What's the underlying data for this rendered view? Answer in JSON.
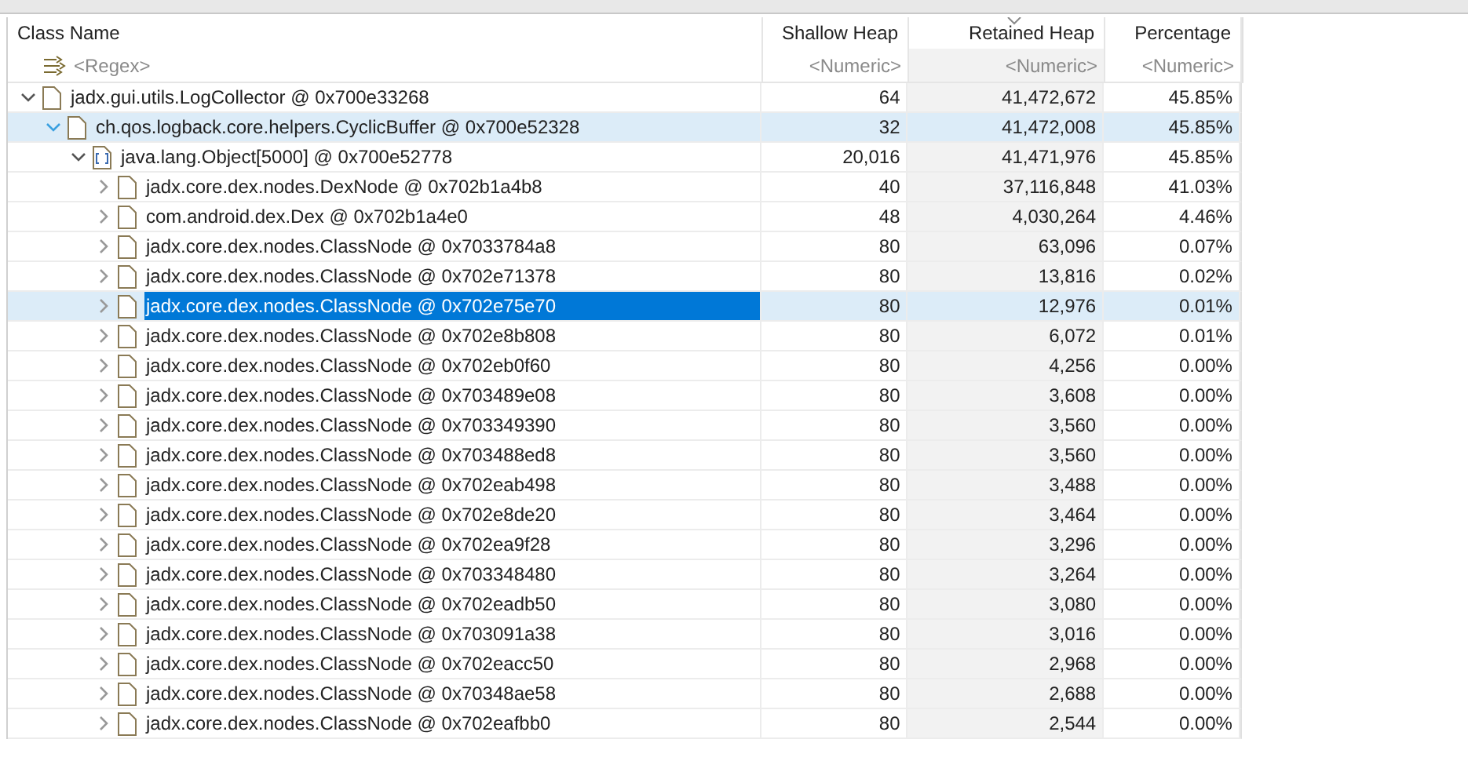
{
  "columns": [
    {
      "label": "Class Name",
      "filter": "<Regex>",
      "sorted": false
    },
    {
      "label": "Shallow Heap",
      "filter": "<Numeric>",
      "sorted": false
    },
    {
      "label": "Retained Heap",
      "filter": "<Numeric>",
      "sorted": true
    },
    {
      "label": "Percentage",
      "filter": "<Numeric>",
      "sorted": false
    }
  ],
  "rows": [
    {
      "kind": "object",
      "name": "jadx.gui.utils.LogCollector @ 0x700e33268",
      "shallow": "64",
      "retained": "41,472,672",
      "percentage": "45.85%",
      "expanded": true,
      "selected": false,
      "hovered": false,
      "children": [
        {
          "kind": "object",
          "name": "ch.qos.logback.core.helpers.CyclicBuffer @ 0x700e52328",
          "shallow": "32",
          "retained": "41,472,008",
          "percentage": "45.85%",
          "expanded": true,
          "selected": false,
          "hovered": true,
          "children": [
            {
              "kind": "array",
              "name": "java.lang.Object[5000] @ 0x700e52778",
              "shallow": "20,016",
              "retained": "41,471,976",
              "percentage": "45.85%",
              "expanded": true,
              "selected": false,
              "hovered": false,
              "children": [
                {
                  "kind": "object",
                  "name": "jadx.core.dex.nodes.DexNode @ 0x702b1a4b8",
                  "shallow": "40",
                  "retained": "37,116,848",
                  "percentage": "41.03%",
                  "expanded": false,
                  "selected": false,
                  "hovered": false
                },
                {
                  "kind": "object",
                  "name": "com.android.dex.Dex @ 0x702b1a4e0",
                  "shallow": "48",
                  "retained": "4,030,264",
                  "percentage": "4.46%",
                  "expanded": false,
                  "selected": false,
                  "hovered": false
                },
                {
                  "kind": "object",
                  "name": "jadx.core.dex.nodes.ClassNode @ 0x7033784a8",
                  "shallow": "80",
                  "retained": "63,096",
                  "percentage": "0.07%",
                  "expanded": false,
                  "selected": false,
                  "hovered": false
                },
                {
                  "kind": "object",
                  "name": "jadx.core.dex.nodes.ClassNode @ 0x702e71378",
                  "shallow": "80",
                  "retained": "13,816",
                  "percentage": "0.02%",
                  "expanded": false,
                  "selected": false,
                  "hovered": false
                },
                {
                  "kind": "object",
                  "name": "jadx.core.dex.nodes.ClassNode @ 0x702e75e70",
                  "shallow": "80",
                  "retained": "12,976",
                  "percentage": "0.01%",
                  "expanded": false,
                  "selected": true,
                  "hovered": false
                },
                {
                  "kind": "object",
                  "name": "jadx.core.dex.nodes.ClassNode @ 0x702e8b808",
                  "shallow": "80",
                  "retained": "6,072",
                  "percentage": "0.01%",
                  "expanded": false,
                  "selected": false,
                  "hovered": false
                },
                {
                  "kind": "object",
                  "name": "jadx.core.dex.nodes.ClassNode @ 0x702eb0f60",
                  "shallow": "80",
                  "retained": "4,256",
                  "percentage": "0.00%",
                  "expanded": false,
                  "selected": false,
                  "hovered": false
                },
                {
                  "kind": "object",
                  "name": "jadx.core.dex.nodes.ClassNode @ 0x703489e08",
                  "shallow": "80",
                  "retained": "3,608",
                  "percentage": "0.00%",
                  "expanded": false,
                  "selected": false,
                  "hovered": false
                },
                {
                  "kind": "object",
                  "name": "jadx.core.dex.nodes.ClassNode @ 0x703349390",
                  "shallow": "80",
                  "retained": "3,560",
                  "percentage": "0.00%",
                  "expanded": false,
                  "selected": false,
                  "hovered": false
                },
                {
                  "kind": "object",
                  "name": "jadx.core.dex.nodes.ClassNode @ 0x703488ed8",
                  "shallow": "80",
                  "retained": "3,560",
                  "percentage": "0.00%",
                  "expanded": false,
                  "selected": false,
                  "hovered": false
                },
                {
                  "kind": "object",
                  "name": "jadx.core.dex.nodes.ClassNode @ 0x702eab498",
                  "shallow": "80",
                  "retained": "3,488",
                  "percentage": "0.00%",
                  "expanded": false,
                  "selected": false,
                  "hovered": false
                },
                {
                  "kind": "object",
                  "name": "jadx.core.dex.nodes.ClassNode @ 0x702e8de20",
                  "shallow": "80",
                  "retained": "3,464",
                  "percentage": "0.00%",
                  "expanded": false,
                  "selected": false,
                  "hovered": false
                },
                {
                  "kind": "object",
                  "name": "jadx.core.dex.nodes.ClassNode @ 0x702ea9f28",
                  "shallow": "80",
                  "retained": "3,296",
                  "percentage": "0.00%",
                  "expanded": false,
                  "selected": false,
                  "hovered": false
                },
                {
                  "kind": "object",
                  "name": "jadx.core.dex.nodes.ClassNode @ 0x703348480",
                  "shallow": "80",
                  "retained": "3,264",
                  "percentage": "0.00%",
                  "expanded": false,
                  "selected": false,
                  "hovered": false
                },
                {
                  "kind": "object",
                  "name": "jadx.core.dex.nodes.ClassNode @ 0x702eadb50",
                  "shallow": "80",
                  "retained": "3,080",
                  "percentage": "0.00%",
                  "expanded": false,
                  "selected": false,
                  "hovered": false
                },
                {
                  "kind": "object",
                  "name": "jadx.core.dex.nodes.ClassNode @ 0x703091a38",
                  "shallow": "80",
                  "retained": "3,016",
                  "percentage": "0.00%",
                  "expanded": false,
                  "selected": false,
                  "hovered": false
                },
                {
                  "kind": "object",
                  "name": "jadx.core.dex.nodes.ClassNode @ 0x702eacc50",
                  "shallow": "80",
                  "retained": "2,968",
                  "percentage": "0.00%",
                  "expanded": false,
                  "selected": false,
                  "hovered": false
                },
                {
                  "kind": "object",
                  "name": "jadx.core.dex.nodes.ClassNode @ 0x70348ae58",
                  "shallow": "80",
                  "retained": "2,688",
                  "percentage": "0.00%",
                  "expanded": false,
                  "selected": false,
                  "hovered": false
                },
                {
                  "kind": "object",
                  "name": "jadx.core.dex.nodes.ClassNode @ 0x702eafbb0",
                  "shallow": "80",
                  "retained": "2,544",
                  "percentage": "0.00%",
                  "expanded": false,
                  "selected": false,
                  "hovered": false
                }
              ]
            }
          ]
        }
      ]
    }
  ]
}
